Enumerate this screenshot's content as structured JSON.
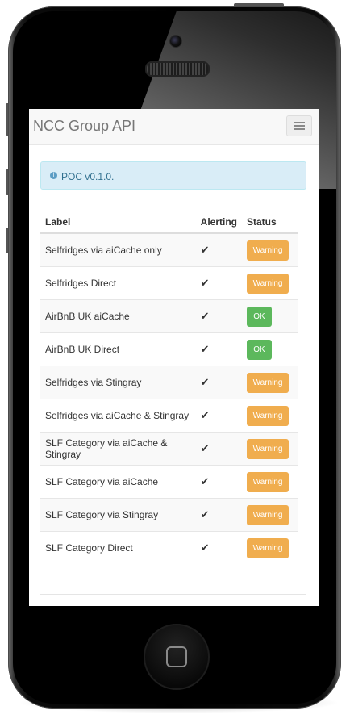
{
  "navbar": {
    "brand": "NCC Group API"
  },
  "alert": {
    "icon": "info-icon",
    "text": "POC v0.1.0."
  },
  "table": {
    "headers": [
      "Label",
      "Alerting",
      "Status"
    ],
    "rows": [
      {
        "label": "Selfridges via aiCache only",
        "alerting": "✔",
        "status": "Warning",
        "status_color": "#f0ad4e"
      },
      {
        "label": "Selfridges Direct",
        "alerting": "✔",
        "status": "Warning",
        "status_color": "#f0ad4e"
      },
      {
        "label": "AirBnB UK aiCache",
        "alerting": "✔",
        "status": "OK",
        "status_color": "#5cb85c"
      },
      {
        "label": "AirBnB UK Direct",
        "alerting": "✔",
        "status": "OK",
        "status_color": "#5cb85c"
      },
      {
        "label": "Selfridges via Stingray",
        "alerting": "✔",
        "status": "Warning",
        "status_color": "#f0ad4e"
      },
      {
        "label": "Selfridges via aiCache & Stingray",
        "alerting": "✔",
        "status": "Warning",
        "status_color": "#f0ad4e"
      },
      {
        "label": "SLF Category via aiCache & Stingray",
        "alerting": "✔",
        "status": "Warning",
        "status_color": "#f0ad4e"
      },
      {
        "label": "SLF Category via aiCache",
        "alerting": "✔",
        "status": "Warning",
        "status_color": "#f0ad4e"
      },
      {
        "label": "SLF Category via Stingray",
        "alerting": "✔",
        "status": "Warning",
        "status_color": "#f0ad4e"
      },
      {
        "label": "SLF Category Direct",
        "alerting": "✔",
        "status": "Warning",
        "status_color": "#f0ad4e"
      }
    ]
  },
  "colors": {
    "warning": "#f0ad4e",
    "ok": "#5cb85c",
    "info_bg": "#d9edf7",
    "info_text": "#31708f"
  }
}
